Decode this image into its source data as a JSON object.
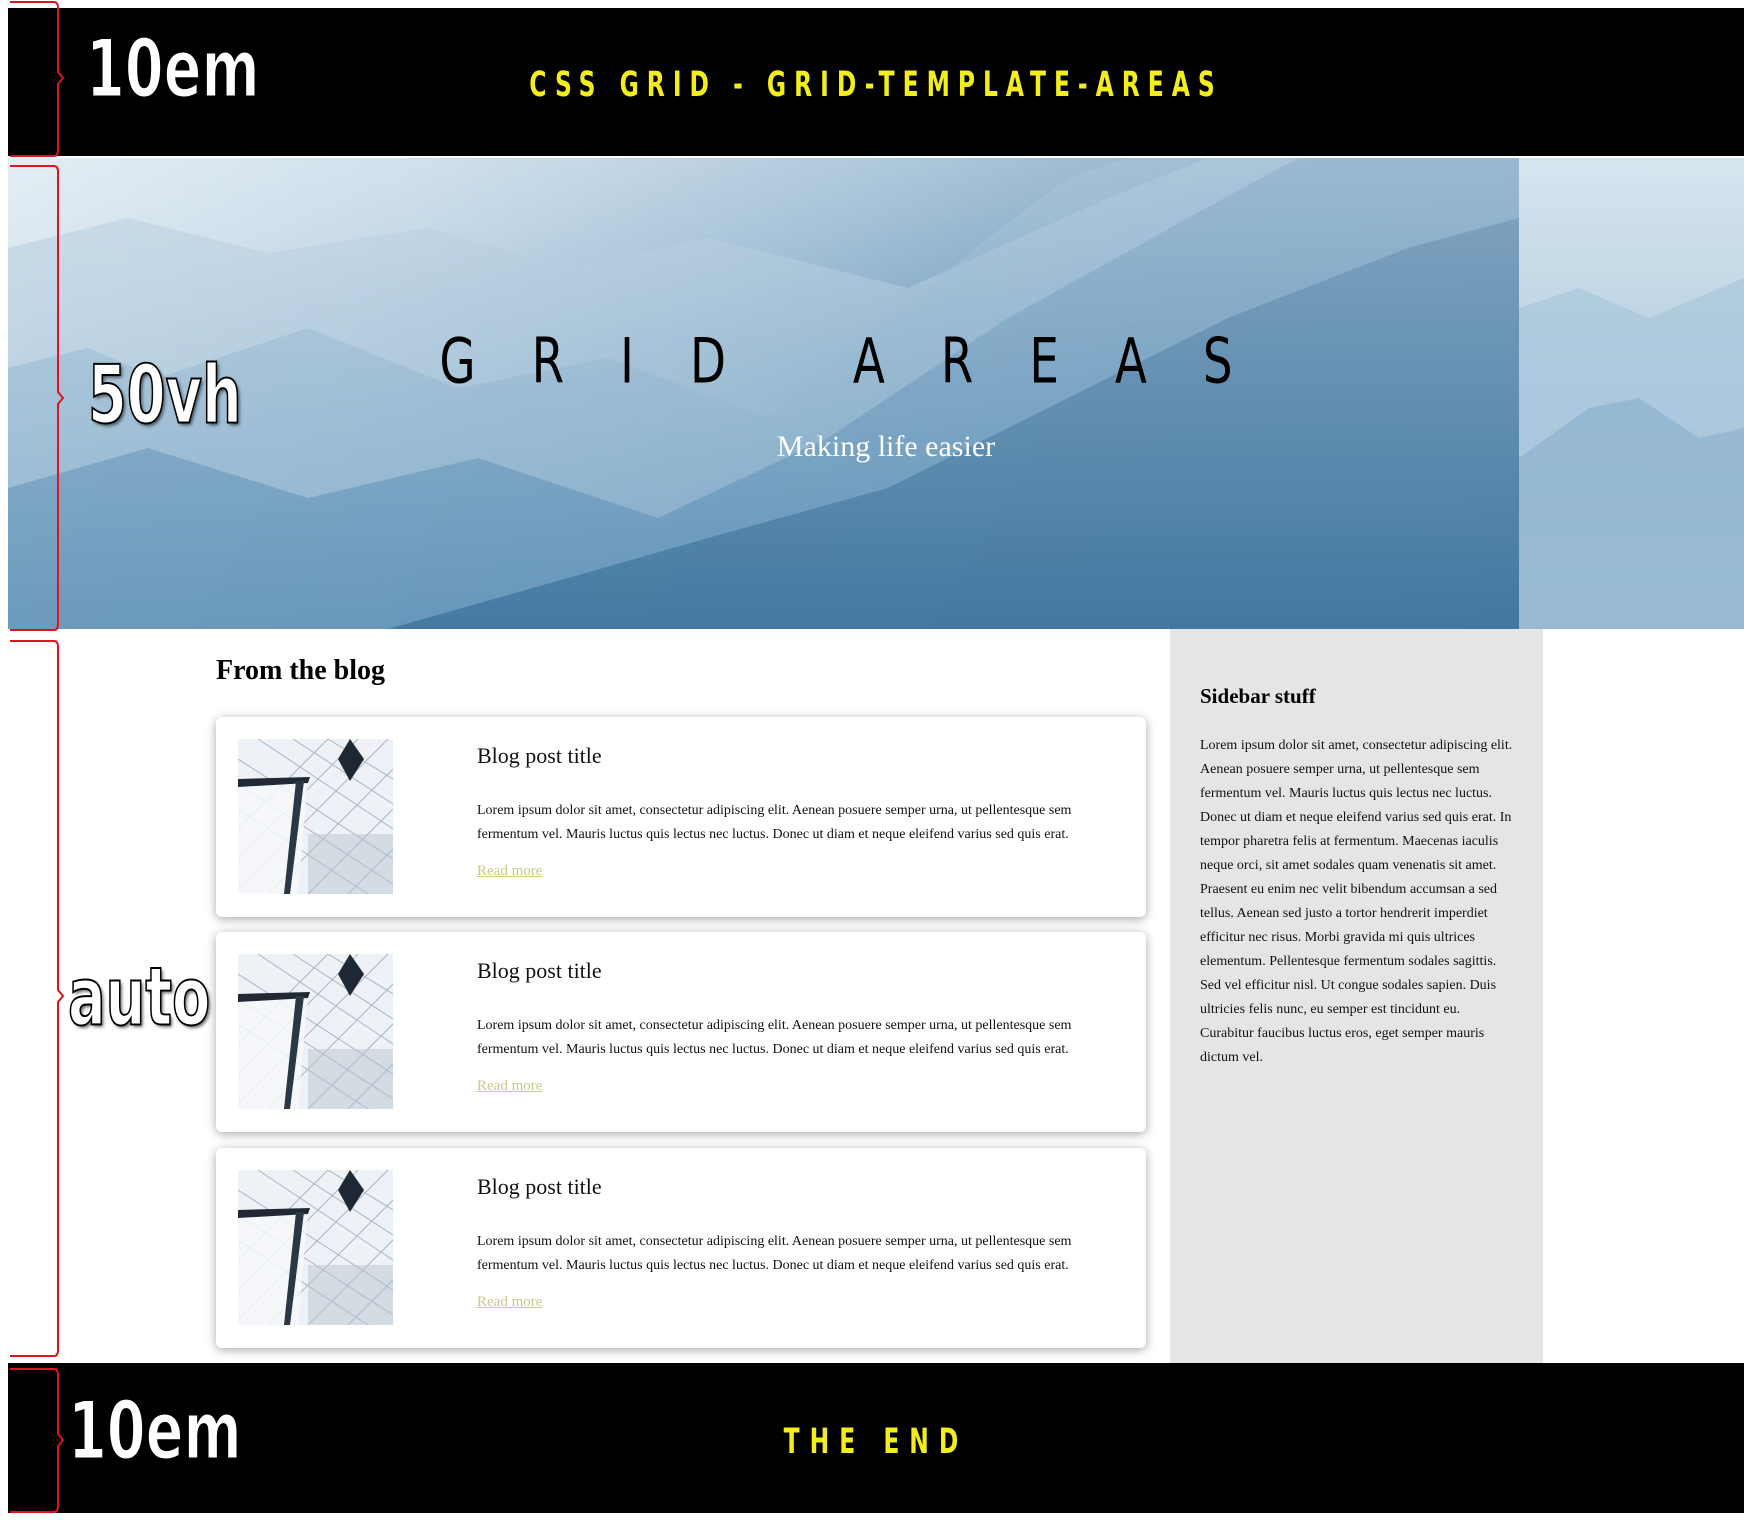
{
  "header": {
    "title": "CSS GRID - GRID-TEMPLATE-AREAS"
  },
  "hero": {
    "title": "GRID AREAS",
    "tagline": "Making life easier"
  },
  "main": {
    "heading": "From the blog",
    "posts": [
      {
        "title": "Blog post title",
        "body": "Lorem ipsum dolor sit amet, consectetur adipiscing elit. Aenean posuere semper urna, ut pellentesque sem fermentum vel. Mauris luctus quis lectus nec luctus. Donec ut diam et neque eleifend varius sed quis erat.",
        "link": "Read more"
      },
      {
        "title": "Blog post title",
        "body": "Lorem ipsum dolor sit amet, consectetur adipiscing elit. Aenean posuere semper urna, ut pellentesque sem fermentum vel. Mauris luctus quis lectus nec luctus. Donec ut diam et neque eleifend varius sed quis erat.",
        "link": "Read more"
      },
      {
        "title": "Blog post title",
        "body": "Lorem ipsum dolor sit amet, consectetur adipiscing elit. Aenean posuere semper urna, ut pellentesque sem fermentum vel. Mauris luctus quis lectus nec luctus. Donec ut diam et neque eleifend varius sed quis erat.",
        "link": "Read more"
      }
    ]
  },
  "sidebar": {
    "title": "Sidebar stuff",
    "body": "Lorem ipsum dolor sit amet, consectetur adipiscing elit. Aenean posuere semper urna, ut pellentesque sem fermentum vel. Mauris luctus quis lectus nec luctus. Donec ut diam et neque eleifend varius sed quis erat. In tempor pharetra felis at fermentum. Maecenas iaculis neque orci, sit amet sodales quam venenatis sit amet. Praesent eu enim nec velit bibendum accumsan a sed tellus. Aenean sed justo a tortor hendrerit imperdiet efficitur nec risus. Morbi gravida mi quis ultrices elementum. Pellentesque fermentum sodales sagittis. Sed vel efficitur nisl. Ut congue sodales sapien. Duis ultricies felis nunc, eu semper est tincidunt eu. Curabitur faucibus luctus eros, eget semper mauris dictum vel."
  },
  "footer": {
    "text": "THE END"
  },
  "annotations": {
    "header_size": "10em",
    "hero_size": "50vh",
    "main_size": "auto",
    "footer_size": "10em"
  },
  "colors": {
    "bar_background": "#000000",
    "bar_text": "#f3ee1b",
    "sidebar_background": "#e5e5e5",
    "link": "#c9c98a",
    "annotation_brace": "#e0141b"
  },
  "icons": {
    "post_thumbnail": "building-glass-facade-image"
  }
}
